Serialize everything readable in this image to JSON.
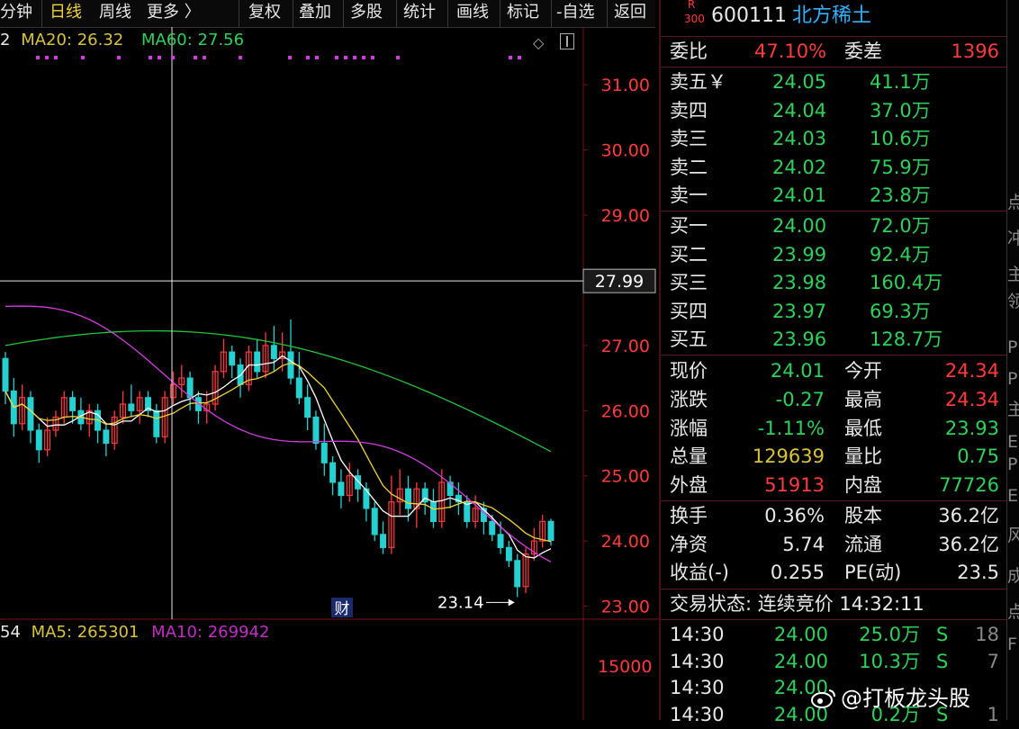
{
  "toolbar": {
    "items": [
      "分钟",
      "日线",
      "周线",
      "更多 〉",
      "复权",
      "叠加",
      "多股",
      "统计",
      "画线",
      "标记",
      "-自选",
      "返回"
    ],
    "active_index": 1
  },
  "legend": {
    "prefix": "2",
    "ma20": "MA20: 26.32",
    "ma60": "MA60: 27.56"
  },
  "crosshair_price": "27.99",
  "annotation_low": "23.14",
  "finance_marker": "财",
  "vol_legend": {
    "prefix": "54",
    "ma5": "MA5: 265301",
    "ma10": "MA10: 269942"
  },
  "vol_axis_label": "15000",
  "colors": {
    "up": "#ff3b3b",
    "down": "#25d0d0",
    "ma5": "#ffffff",
    "ma10": "#f0d23c",
    "ma20": "#d23be0",
    "ma60": "#22c43a"
  },
  "chart_data": {
    "type": "candlestick",
    "ylim": [
      22.8,
      31.5
    ],
    "yticks": [
      "31.00",
      "30.00",
      "29.00",
      "28.00",
      "27.00",
      "26.00",
      "25.00",
      "24.00",
      "23.00"
    ],
    "candles": [
      [
        26.8,
        26.3,
        26.9,
        26.1
      ],
      [
        26.3,
        25.8,
        26.5,
        25.6
      ],
      [
        25.8,
        26.2,
        26.4,
        25.7
      ],
      [
        26.2,
        25.7,
        26.3,
        25.5
      ],
      [
        25.7,
        25.4,
        25.8,
        25.2
      ],
      [
        25.4,
        25.7,
        25.9,
        25.3
      ],
      [
        25.7,
        25.9,
        26.0,
        25.6
      ],
      [
        25.9,
        26.2,
        26.3,
        25.8
      ],
      [
        26.2,
        26.0,
        26.3,
        25.8
      ],
      [
        26.0,
        25.8,
        26.2,
        25.7
      ],
      [
        25.8,
        26.0,
        26.1,
        25.6
      ],
      [
        26.0,
        25.7,
        26.1,
        25.5
      ],
      [
        25.7,
        25.5,
        25.8,
        25.3
      ],
      [
        25.5,
        25.9,
        26.0,
        25.4
      ],
      [
        25.9,
        26.1,
        26.3,
        25.8
      ],
      [
        26.1,
        26.0,
        26.4,
        25.9
      ],
      [
        26.0,
        26.2,
        26.3,
        25.8
      ],
      [
        26.2,
        26.0,
        26.3,
        25.9
      ],
      [
        26.0,
        25.6,
        26.1,
        25.5
      ],
      [
        25.6,
        26.2,
        26.3,
        25.5
      ],
      [
        26.2,
        26.4,
        26.6,
        26.1
      ],
      [
        26.4,
        26.5,
        26.7,
        26.2
      ],
      [
        26.5,
        26.2,
        26.6,
        26.0
      ],
      [
        26.2,
        26.0,
        26.3,
        25.8
      ],
      [
        26.0,
        26.1,
        26.3,
        25.8
      ],
      [
        26.1,
        26.6,
        26.7,
        26.0
      ],
      [
        26.6,
        26.9,
        27.1,
        26.5
      ],
      [
        26.9,
        26.7,
        27.0,
        26.5
      ],
      [
        26.7,
        26.4,
        26.8,
        26.2
      ],
      [
        26.4,
        26.9,
        27.0,
        26.3
      ],
      [
        26.9,
        26.6,
        27.1,
        26.5
      ],
      [
        26.6,
        27.0,
        27.2,
        26.5
      ],
      [
        27.0,
        26.8,
        27.3,
        26.6
      ],
      [
        26.8,
        26.9,
        27.2,
        26.6
      ],
      [
        26.9,
        26.5,
        27.4,
        26.4
      ],
      [
        26.5,
        26.2,
        26.9,
        26.1
      ],
      [
        26.2,
        25.9,
        26.4,
        25.7
      ],
      [
        25.9,
        25.5,
        26.0,
        25.4
      ],
      [
        25.5,
        25.2,
        25.8,
        25.0
      ],
      [
        25.2,
        24.9,
        25.3,
        24.7
      ],
      [
        24.9,
        24.7,
        25.1,
        24.5
      ],
      [
        24.7,
        25.0,
        25.2,
        24.6
      ],
      [
        25.0,
        24.8,
        25.1,
        24.6
      ],
      [
        24.8,
        24.5,
        24.9,
        24.3
      ],
      [
        24.5,
        24.1,
        24.6,
        24.0
      ],
      [
        24.1,
        23.9,
        24.3,
        23.8
      ],
      [
        23.9,
        24.6,
        25.0,
        23.8
      ],
      [
        24.6,
        24.8,
        25.1,
        24.4
      ],
      [
        24.8,
        24.5,
        25.0,
        24.3
      ],
      [
        24.5,
        24.8,
        24.9,
        24.2
      ],
      [
        24.8,
        24.6,
        24.9,
        24.4
      ],
      [
        24.6,
        24.3,
        24.8,
        24.2
      ],
      [
        24.3,
        24.9,
        25.1,
        24.2
      ],
      [
        24.9,
        24.7,
        25.0,
        24.5
      ],
      [
        24.7,
        24.6,
        24.9,
        24.4
      ],
      [
        24.6,
        24.3,
        24.7,
        24.2
      ],
      [
        24.3,
        24.5,
        24.7,
        24.2
      ],
      [
        24.5,
        24.3,
        24.6,
        24.1
      ],
      [
        24.3,
        24.1,
        24.4,
        24.0
      ],
      [
        24.1,
        23.9,
        24.3,
        23.8
      ],
      [
        23.9,
        23.7,
        24.0,
        23.6
      ],
      [
        23.7,
        23.3,
        23.8,
        23.14
      ],
      [
        23.3,
        23.8,
        23.9,
        23.2
      ],
      [
        23.8,
        24.0,
        24.2,
        23.7
      ],
      [
        24.0,
        24.3,
        24.4,
        23.9
      ],
      [
        24.3,
        24.01,
        24.34,
        23.93
      ]
    ]
  },
  "quote": {
    "badge_top": "R",
    "badge_bottom": "300",
    "code": "600111",
    "name": "北方稀土",
    "webi_label": "委比",
    "webi": "47.10%",
    "weicha_label": "委差",
    "weicha": "1396",
    "asks": [
      {
        "label": "卖五￥",
        "price": "24.05",
        "vol": "41.1万"
      },
      {
        "label": "卖四",
        "price": "24.04",
        "vol": "37.0万"
      },
      {
        "label": "卖三",
        "price": "24.03",
        "vol": "10.6万"
      },
      {
        "label": "卖二",
        "price": "24.02",
        "vol": "75.9万"
      },
      {
        "label": "卖一",
        "price": "24.01",
        "vol": "23.8万"
      }
    ],
    "bids": [
      {
        "label": "买一",
        "price": "24.00",
        "vol": "72.0万"
      },
      {
        "label": "买二",
        "price": "23.99",
        "vol": "92.4万"
      },
      {
        "label": "买三",
        "price": "23.98",
        "vol": "160.4万"
      },
      {
        "label": "买四",
        "price": "23.97",
        "vol": "69.3万"
      },
      {
        "label": "买五",
        "price": "23.96",
        "vol": "128.7万"
      }
    ],
    "stats": [
      {
        "l1": "现价",
        "v1": "24.01",
        "c1": "g",
        "l2": "今开",
        "v2": "24.34",
        "c2": "r"
      },
      {
        "l1": "涨跌",
        "v1": "-0.27",
        "c1": "g",
        "l2": "最高",
        "v2": "24.34",
        "c2": "r"
      },
      {
        "l1": "涨幅",
        "v1": "-1.11%",
        "c1": "g",
        "l2": "最低",
        "v2": "23.93",
        "c2": "g"
      },
      {
        "l1": "总量",
        "v1": "129639",
        "c1": "y",
        "l2": "量比",
        "v2": "0.75",
        "c2": "g"
      },
      {
        "l1": "外盘",
        "v1": "51913",
        "c1": "r",
        "l2": "内盘",
        "v2": "77726",
        "c2": "g"
      }
    ],
    "stats2": [
      {
        "l1": "换手",
        "v1": "0.36%",
        "l2": "股本",
        "v2": "36.2亿"
      },
      {
        "l1": "净资",
        "v1": "5.74",
        "l2": "流通",
        "v2": "36.2亿"
      },
      {
        "l1": "收益(-)",
        "v1": "0.255",
        "l2": "PE(动)",
        "v2": "23.5"
      }
    ],
    "status": "交易状态: 连续竞价 14:32:11",
    "ticks": [
      {
        "time": "14:30",
        "price": "24.00",
        "vol": "25.0万",
        "flag": "S",
        "n": "18"
      },
      {
        "time": "14:30",
        "price": "24.00",
        "vol": "10.3万",
        "flag": "S",
        "n": "7"
      },
      {
        "time": "14:30",
        "price": "24.00",
        "vol": "",
        "flag": "",
        "n": ""
      },
      {
        "time": "14:30",
        "price": "24.00",
        "vol": "0.2万",
        "flag": "S",
        "n": "1"
      }
    ]
  },
  "edge_chars": [
    "点",
    "冲",
    "主",
    "领",
    "P",
    "P",
    "主",
    "E",
    "P",
    "E",
    "风",
    "成",
    "点",
    "F"
  ],
  "watermark": "@打板龙头股"
}
